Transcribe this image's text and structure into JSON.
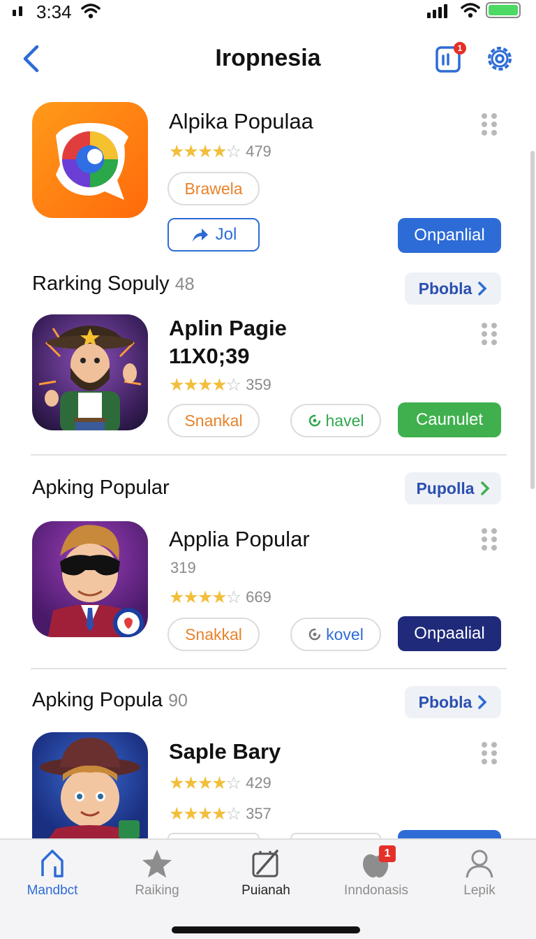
{
  "status_bar": {
    "time": "3:34"
  },
  "nav": {
    "title": "Iropnesia",
    "news_badge": "1"
  },
  "featured": {
    "name": "Alpika Populaa",
    "rating_count": "479",
    "tag": "Brawela",
    "share_label": "Jol",
    "action_label": "Onpanlial"
  },
  "sections": [
    {
      "title": "Rarking Sopuly",
      "count": "48",
      "see_all": "Pbobla",
      "app": {
        "name_line1": "Aplin Pagie",
        "name_line2": "11X0;39",
        "rating_count": "359",
        "tag": "Snankal",
        "secondary_label": "havel",
        "action_label": "Caunulet"
      }
    },
    {
      "title": "Apking Popular",
      "count": "",
      "see_all": "Pupolla",
      "app": {
        "name": "Applia Popular",
        "sub_number": "319",
        "rating_count": "669",
        "tag": "Snakkal",
        "secondary_label": "kovel",
        "action_label": "Onpaalial"
      }
    },
    {
      "title": "Apking Popula",
      "count": "90",
      "see_all": "Pbobla",
      "app": {
        "name": "Saple Bary",
        "rating_count_1": "429",
        "rating_count_2": "357"
      }
    }
  ],
  "tabs": [
    {
      "label": "Mandbct",
      "icon": "home-icon"
    },
    {
      "label": "Raiking",
      "icon": "star-icon"
    },
    {
      "label": "Puianah",
      "icon": "edit-icon"
    },
    {
      "label": "Inndonasis",
      "icon": "apple-icon",
      "badge": "1"
    },
    {
      "label": "Lepik",
      "icon": "person-icon"
    }
  ],
  "colors": {
    "accent": "#2d6cd6",
    "green": "#3fb04d",
    "navy": "#1f2a7a",
    "star": "#f2bf3c"
  }
}
